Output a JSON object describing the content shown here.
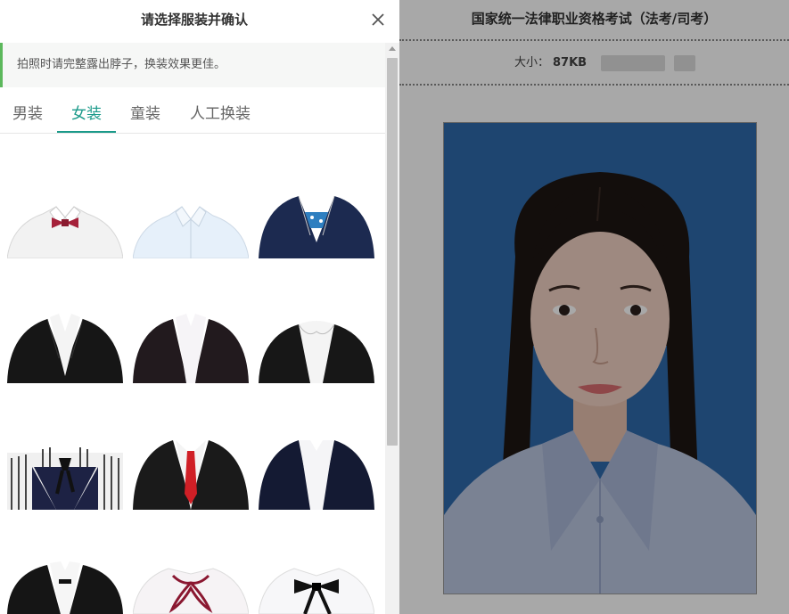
{
  "background_page": {
    "title": "国家统一法律职业资格考试（法考/司考）",
    "size_label": "大小：",
    "size_value": "87KB",
    "photo_bg_color": "#2e6aab"
  },
  "modal": {
    "title": "请选择服装并确认",
    "notice": "拍照时请完整露出脖子，换装效果更佳。",
    "accent_color": "#1b9a8a",
    "tabs": [
      {
        "label": "男装"
      },
      {
        "label": "女装"
      },
      {
        "label": "童装"
      },
      {
        "label": "人工换装"
      }
    ],
    "active_tab": "女装",
    "clothes": [
      {
        "icon": "white-shirt-red-bowtie-icon"
      },
      {
        "icon": "light-blue-shirt-icon"
      },
      {
        "icon": "navy-blazer-blue-scarf-icon"
      },
      {
        "icon": "black-suit-white-shirt-icon"
      },
      {
        "icon": "black-suit-white-blouse-icon"
      },
      {
        "icon": "black-suit-round-collar-icon"
      },
      {
        "icon": "striped-shirt-navy-vest-icon"
      },
      {
        "icon": "black-suit-red-tie-icon"
      },
      {
        "icon": "navy-suit-white-shirt-icon"
      },
      {
        "icon": "black-suit-bow-collar-icon"
      },
      {
        "icon": "white-blouse-red-ribbon-icon"
      },
      {
        "icon": "white-blouse-black-bow-icon"
      }
    ]
  }
}
